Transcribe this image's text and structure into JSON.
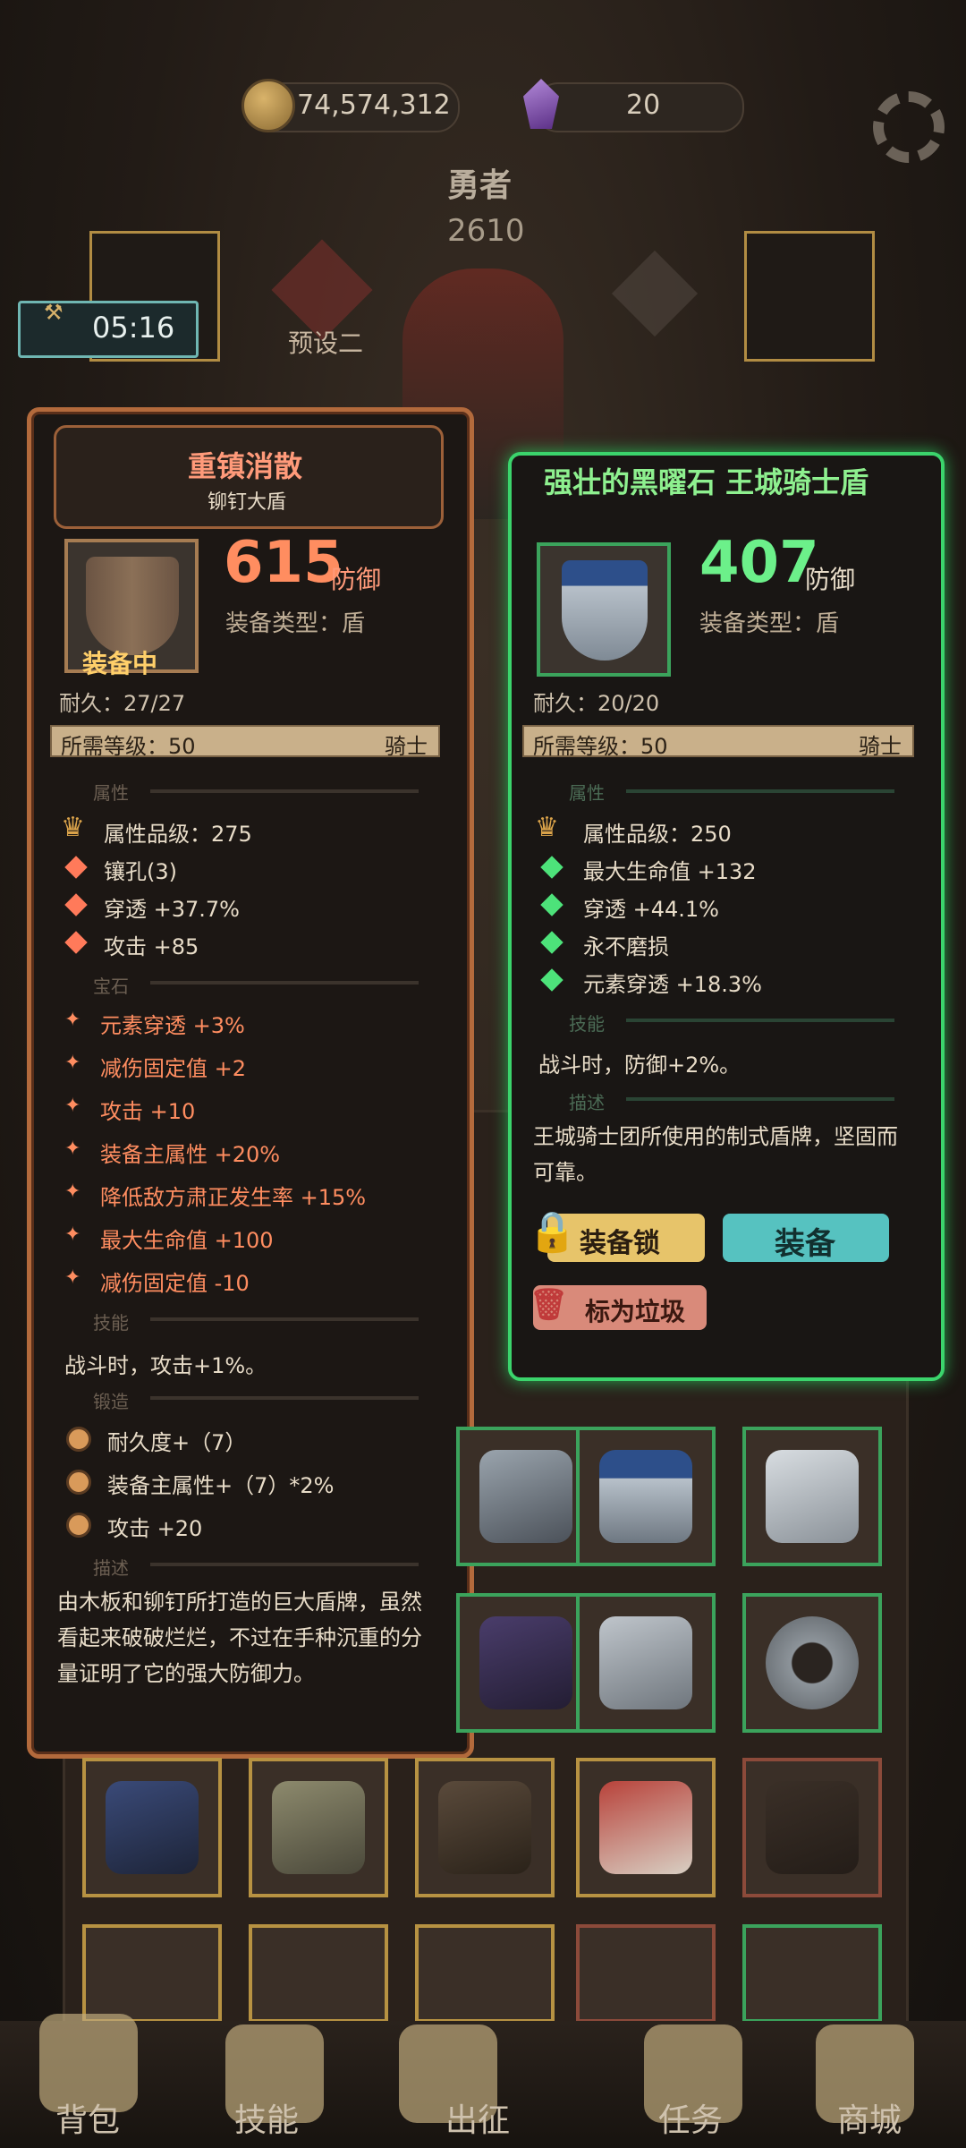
{
  "topbar": {
    "coins": "74,574,312",
    "gems": "20",
    "coin_icon": "coin-icon",
    "gem_icon": "gem-icon",
    "settings_icon": "gear-icon"
  },
  "hero": {
    "title": "勇者",
    "score": "2610",
    "timer": "05:16",
    "preset": "预设二"
  },
  "left_item": {
    "name": "重镇消散",
    "subtype": "铆钉大盾",
    "defense": "615",
    "defense_unit": "防御",
    "equip_type": "装备类型：盾",
    "status": "装备中",
    "durability": "耐久：27/27",
    "level_req": "所需等级：50",
    "class": "骑士",
    "sections": {
      "attr": "属性",
      "gem": "宝石",
      "skill": "技能",
      "forge": "锻造",
      "desc": "描述"
    },
    "attrs": [
      "属性品级：275",
      "镶孔(3)",
      "穿透 +37.7%",
      "攻击 +85"
    ],
    "gems": [
      "元素穿透 +3%",
      "减伤固定值 +2",
      "攻击 +10",
      "装备主属性 +20%",
      "降低敌方肃正发生率 +15%",
      "最大生命值 +100",
      "减伤固定值 -10"
    ],
    "skill": "战斗时，攻击+1%。",
    "forge": [
      "耐久度+（7）",
      "装备主属性+（7）*2%",
      "攻击 +20"
    ],
    "description": "由木板和铆钉所打造的巨大盾牌，虽然看起来破破烂烂，不过在手种沉重的分量证明了它的强大防御力。"
  },
  "right_item": {
    "name": "强壮的黑曜石 王城骑士盾",
    "defense": "407",
    "defense_unit": "防御",
    "equip_type": "装备类型：盾",
    "durability": "耐久：20/20",
    "level_req": "所需等级：50",
    "class": "骑士",
    "sections": {
      "attr": "属性",
      "skill": "技能",
      "desc": "描述"
    },
    "attrs": [
      "属性品级：250",
      "最大生命值 +132",
      "穿透 +44.1%",
      "永不磨损",
      "元素穿透 +18.3%"
    ],
    "skill": "战斗时，防御+2%。",
    "description": "王城骑士团所使用的制式盾牌，坚固而可靠。",
    "buttons": {
      "lock": "装备锁",
      "equip": "装备",
      "trash": "标为垃圾"
    }
  },
  "nav": [
    "背包",
    "技能",
    "出征",
    "任务",
    "商城"
  ],
  "colors": {
    "accent_green": "#3bd46c",
    "accent_orange": "#ff8d60",
    "gold": "#b79242"
  }
}
